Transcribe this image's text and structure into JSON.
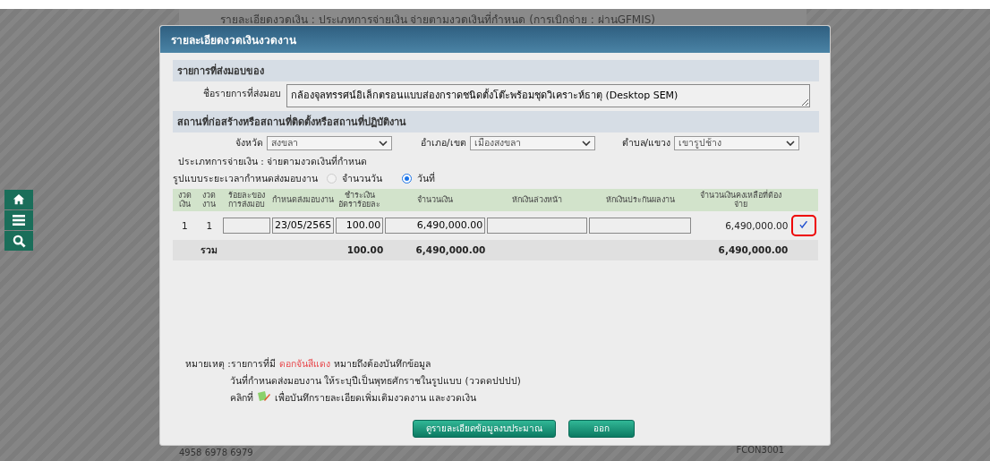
{
  "backdrop": {
    "header_text": "รายละเอียดงวดเงิน : ประเภทการจ่ายเงิน จ่ายตามงวดเงินที่กำหนด (การเบิกจ่าย : ผ่านGFMIS)",
    "footer_text": "4958 6978 6979",
    "footer_code": "FCON3001",
    "nav": [
      {
        "kind": "home"
      },
      {
        "kind": "menu"
      },
      {
        "kind": "search"
      }
    ]
  },
  "dialog": {
    "title": "รายละเอียดงวดเงินงวดงาน",
    "delivery": {
      "heading": "รายการที่ส่งมอบของ",
      "label": "ชื่อรายการที่ส่งมอบ",
      "value": "กล้องจุลทรรศน์อิเล็กตรอนแบบส่องกราดชนิดตั้งโต๊ะพร้อมชุดวิเคราะห์ธาตุ (Desktop SEM)"
    },
    "location": {
      "heading": "สถานที่ก่อสร้างหรือสถานที่ติดตั้งหรือสถานที่ปฏิบัติงาน",
      "selects": [
        {
          "label": "จังหวัด",
          "value": "สงขลา"
        },
        {
          "label": "อำเภอ/เขต",
          "value": "เมืองสงขลา"
        },
        {
          "label": "ตำบล/แขวง",
          "value": "เขารูปช้าง"
        }
      ],
      "payment_type": "ประเภทการจ่ายเงิน : จ่ายตามงวดเงินที่กำหนด",
      "schedule": {
        "label": "รูปแบบระยะเวลากำหนดส่งมอบงาน",
        "options": [
          {
            "label": "จำนวนวัน",
            "selected": false,
            "disabled": true
          },
          {
            "label": "วันที่",
            "selected": true,
            "disabled": false
          }
        ]
      }
    },
    "table": {
      "columns": [
        "งวดเงิน",
        "งวดงาน",
        "ร้อยละของการส่งมอบ",
        "กำหนดส่งมอบงาน",
        "ชำระเงินอัตราร้อยละ",
        "จำนวนเงิน",
        "หักเงินล่วงหน้า",
        "หักเงินประกันผลงาน",
        "จำนวนเงินคงเหลือที่ต้องจ่าย"
      ],
      "rows": [
        {
          "cells": [
            {
              "kind": "text",
              "value": "1"
            },
            {
              "kind": "text",
              "value": "1"
            },
            {
              "kind": "input"
            },
            {
              "kind": "input",
              "value": "23/05/2565"
            },
            {
              "kind": "input",
              "value": "100.00"
            },
            {
              "kind": "input",
              "value": "6,490,000.00"
            },
            {
              "kind": "input"
            },
            {
              "kind": "input"
            },
            {
              "kind": "text",
              "value": "6,490,000.00"
            }
          ],
          "highlighted": true
        }
      ],
      "total": {
        "label": "รวม",
        "rate": "100.00",
        "amount": "6,490,000.00",
        "remaining": "6,490,000.00"
      }
    },
    "notes": {
      "label": "หมายเหตุ :",
      "lines": [
        [
          {
            "kind": "text",
            "text": "รายการที่มี"
          },
          {
            "kind": "warn",
            "text": "ดอกจันสีแดง"
          },
          {
            "kind": "text",
            "text": "หมายถึงต้องบันทึกข้อมูล"
          }
        ],
        [
          {
            "kind": "text",
            "text": "วันที่กำหนดส่งมอบงาน ให้ระบุปีเป็นพุทธศักราชในรูปแบบ (ววดดปปปป)"
          }
        ],
        [
          {
            "kind": "text",
            "text": "คลิกที่"
          },
          {
            "kind": "icon"
          },
          {
            "kind": "text",
            "text": "เพื่อบันทึกรายละเอียดเพิ่มเติมงวดงาน และงวดเงิน"
          }
        ]
      ]
    },
    "buttons": [
      "ดูรายละเอียดข้อมูลงบประมาณ",
      "ออก"
    ]
  }
}
